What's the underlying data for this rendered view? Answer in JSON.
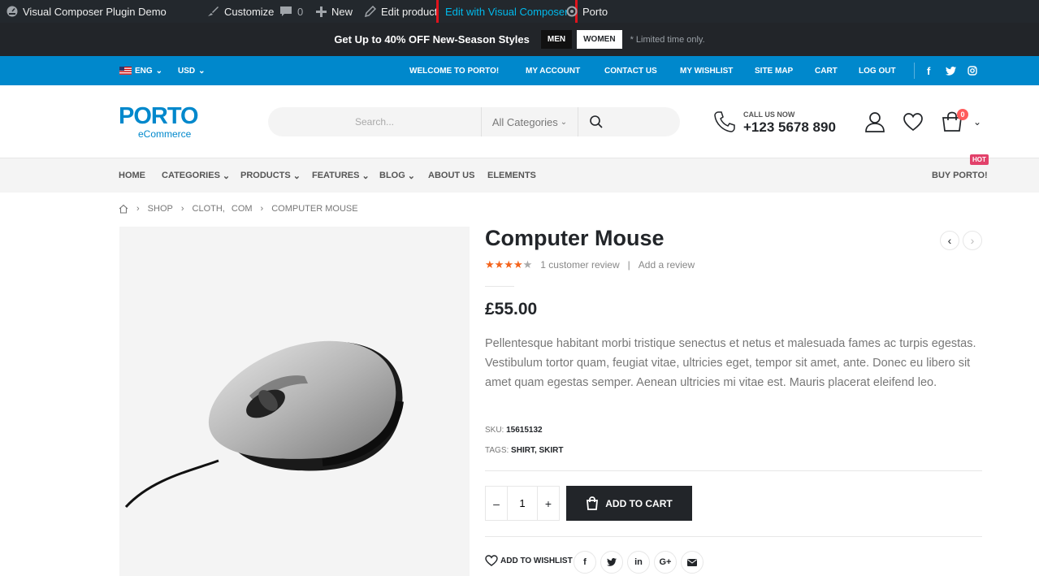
{
  "admin_bar": {
    "site_name": "Visual Composer Plugin Demo",
    "customize": "Customize",
    "comments_count": "0",
    "new": "New",
    "edit_product": "Edit product",
    "edit_vc": "Edit with Visual Composer",
    "porto": "Porto"
  },
  "promo": {
    "text_prefix": "Get Up to ",
    "text_bold": "40% OFF",
    "text_suffix": " New-Season Styles",
    "tag_men": "MEN",
    "tag_women": "WOMEN",
    "note": "* Limited time only."
  },
  "topbar": {
    "language": "ENG",
    "currency": "USD",
    "links": [
      "WELCOME TO PORTO!",
      "MY ACCOUNT",
      "CONTACT US",
      "MY WISHLIST",
      "SITE MAP",
      "CART",
      "LOG OUT"
    ]
  },
  "header": {
    "logo": "PORTO",
    "logo_sub": "eCommerce",
    "search_placeholder": "Search...",
    "category": "All Categories",
    "call_label": "CALL US NOW",
    "phone": "+123 5678 890",
    "cart_count": "0"
  },
  "nav": {
    "items": [
      "HOME",
      "CATEGORIES",
      "PRODUCTS",
      "FEATURES",
      "BLOG",
      "ABOUT US",
      "ELEMENTS"
    ],
    "buy": "BUY PORTO!",
    "hot": "HOT"
  },
  "breadcrumb": [
    "SHOP",
    "CLOTH,",
    "COM",
    "COMPUTER MOUSE"
  ],
  "product": {
    "title": "Computer Mouse",
    "rating": 4,
    "reviews": "1 customer review",
    "add_review": "Add a review",
    "price": "£55.00",
    "description": "Pellentesque habitant morbi tristique senectus et netus et malesuada fames ac turpis egestas. Vestibulum tortor quam, feugiat vitae, ultricies eget, tempor sit amet, ante. Donec eu libero sit amet quam egestas semper. Aenean ultricies mi vitae est. Mauris placerat eleifend leo.",
    "sku_label": "SKU:",
    "sku": "15615132",
    "tags_label": "TAGS:",
    "tags": [
      "SHIRT",
      "SKIRT"
    ],
    "quantity": "1",
    "add_to_cart": "ADD TO CART",
    "wishlist": "ADD TO WISHLIST"
  },
  "colors": {
    "admin_bg": "#23282d",
    "promo_bg": "#222529",
    "brand_blue": "#0088cc",
    "highlight": "#e1131c",
    "hot": "#e2416a",
    "star": "#f4631b"
  }
}
